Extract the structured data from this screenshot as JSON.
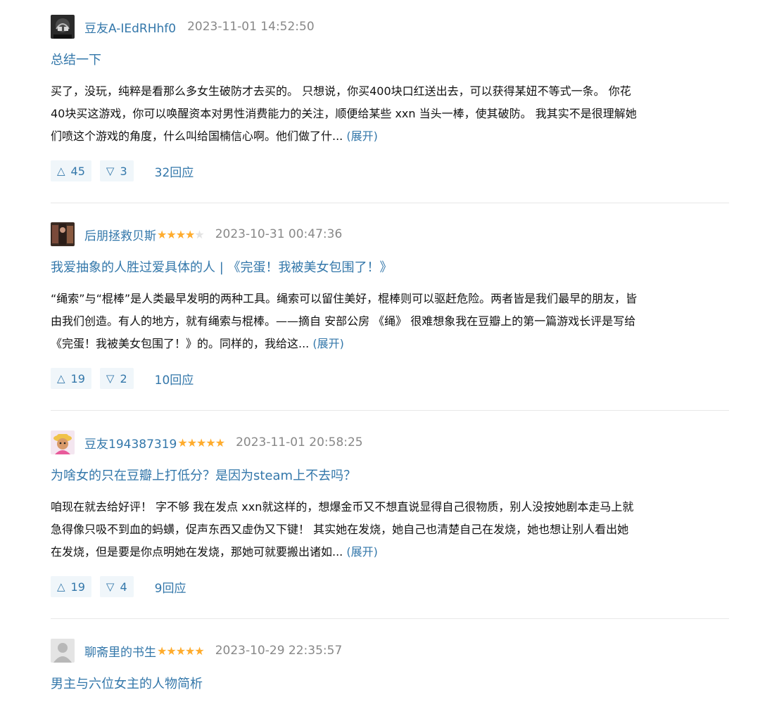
{
  "reviews": [
    {
      "author": "豆友A-IEdRHhf0",
      "rating": 0,
      "time": "2023-11-01 14:52:50",
      "title": "总结一下",
      "lines": [
        "买了，没玩，纯粹是看那么多女生破防才去买的。 只想说，你买400块口红送出去，可以获得某妞不等式一条。 你花",
        "40块买这游戏，你可以唤醒资本对男性消费能力的关注，顺便给某些 xxn 当头一棒，使其破防。 我其实不是很理解她",
        "们喷这个游戏的角度，什么叫给国楠信心啊。他们做了什... "
      ],
      "expand": "(展开)",
      "up": "45",
      "down": "3",
      "replies": "32回应"
    },
    {
      "author": "后朋拯救贝斯",
      "rating": 4,
      "time": "2023-10-31 00:47:36",
      "title": "我爱抽象的人胜过爱具体的人 | 《完蛋！我被美女包围了！》",
      "lines": [
        "“绳索”与“棍棒”是人类最早发明的两种工具。绳索可以留住美好，棍棒则可以驱赶危险。两者皆是我们最早的朋友，皆",
        "由我们创造。有人的地方，就有绳索与棍棒。——摘自 安部公房 《绳》 很难想象我在豆瓣上的第一篇游戏长评是写给",
        "《完蛋！我被美女包围了！》的。同样的，我给这... "
      ],
      "expand": "(展开)",
      "up": "19",
      "down": "2",
      "replies": "10回应"
    },
    {
      "author": "豆友194387319",
      "rating": 5,
      "time": "2023-11-01 20:58:25",
      "title": "为啥女的只在豆瓣上打低分？是因为steam上不去吗？",
      "lines": [
        "咱现在就去给好评！ 字不够 我在发点 xxn就这样的，想爆金币又不想直说显得自己很物质，别人没按她剧本走马上就",
        "急得像只吸不到血的蚂蟥，促声东西又虚伪又下键！ 其实她在发烧，她自己也清楚自己在发烧，她也想让别人看出她",
        "在发烧，但是要是你点明她在发烧，那她可就要搬出诸如... "
      ],
      "expand": "(展开)",
      "up": "19",
      "down": "4",
      "replies": "9回应"
    },
    {
      "author": "聊斋里的书生",
      "rating": 5,
      "time": "2023-10-29 22:35:57",
      "title": "男主与六位女主的人物简析"
    }
  ],
  "icons": {
    "upvote": "△",
    "downvote": "▽",
    "star": "★"
  },
  "colors": {
    "link": "#3377aa",
    "star_on": "#ffac2d",
    "star_off": "#e3e3e3",
    "vote_bg": "#f0f6fa",
    "timestamp": "#888888"
  }
}
